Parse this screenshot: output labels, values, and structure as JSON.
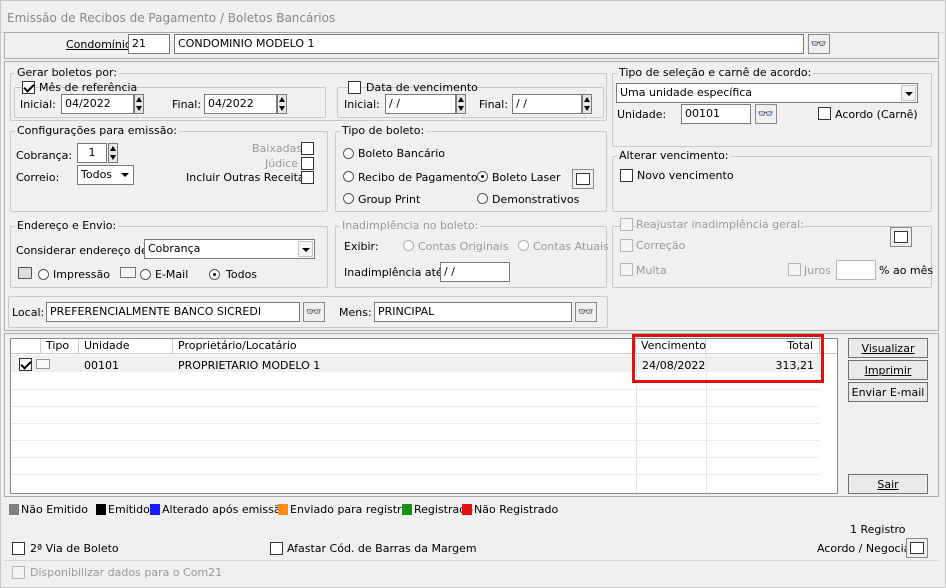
{
  "title": "Emissão de Recibos de Pagamento / Boletos Bancários",
  "condominio": {
    "label": "Condomínio:",
    "code": "21",
    "name": "CONDOMINIO MODELO 1"
  },
  "gerar": {
    "title": "Gerar boletos por:",
    "mes_label": "Mês de referência",
    "inicial_label": "Inicial:",
    "inicial": "04/2022",
    "final_label": "Final:",
    "final": "04/2022",
    "data_label": "Data de vencimento",
    "data_inicial": " / /",
    "data_final": " / /"
  },
  "tipo_selecao": {
    "title": "Tipo de seleção e carnê de acordo:",
    "selected": "Uma unidade específica",
    "unidade_label": "Unidade:",
    "unidade": "00101",
    "acordo_label": "Acordo (Carnê)"
  },
  "config": {
    "title": "Configurações para emissão:",
    "cobranca_label": "Cobrança:",
    "cobranca": "1",
    "correio_label": "Correio:",
    "correio": "Todos",
    "baixadas": "Baixadas",
    "judice": "Júdice",
    "incluir": "Incluir Outras Receitas"
  },
  "tipo_boleto": {
    "title": "Tipo de boleto:",
    "bancario": "Boleto Bancário",
    "recibo": "Recibo de Pagamento",
    "laser": "Boleto Laser",
    "group": "Group Print",
    "demonstrativos": "Demonstrativos"
  },
  "alterar": {
    "title": "Alterar vencimento:",
    "novo": "Novo vencimento"
  },
  "endereco": {
    "title": "Endereço e Envio:",
    "considerar_label": "Considerar endereço de:",
    "considerar": "Cobrança",
    "impressao": "Impressão",
    "email": "E-Mail",
    "todos": "Todos"
  },
  "inad": {
    "title": "Inadimplência no boleto:",
    "exibir": "Exibir:",
    "originais": "Contas Originais",
    "atuais": "Contas Atuais",
    "ate_label": "Inadimplência até:",
    "ate": " / /"
  },
  "reajustar": {
    "title": "Reajustar inadimplência geral:",
    "correcao": "Correção",
    "multa": "Multa",
    "juros": "Juros",
    "ao_mes": "% ao mês"
  },
  "local": {
    "label": "Local:",
    "value": "PREFERENCIALMENTE BANCO SICREDI",
    "mens_label": "Mens:",
    "mens": "PRINCIPAL"
  },
  "table": {
    "headers": [
      "Tipo",
      "Unidade",
      "Proprietário/Locatário",
      "Vencimento",
      "Total"
    ],
    "rows": [
      {
        "unidade": "00101",
        "proprietario": "PROPRIETARIO MODELO 1",
        "vencimento": "24/08/2022",
        "total": "313,21"
      }
    ]
  },
  "buttons": {
    "visualizar": "Visualizar",
    "imprimir": "Imprimir",
    "enviar": "Enviar E-mail",
    "sair": "Sair"
  },
  "legend": [
    {
      "label": "Não Emitido",
      "color": "#808080"
    },
    {
      "label": "Emitido",
      "color": "#000000"
    },
    {
      "label": "Alterado após emissão",
      "color": "#1a1aff"
    },
    {
      "label": "Enviado para registro",
      "color": "#ff8c1a"
    },
    {
      "label": "Registrado",
      "color": "#1a8c1a"
    },
    {
      "label": "Não Registrado",
      "color": "#e01010"
    }
  ],
  "footer": {
    "registros": "1 Registro",
    "segunda_via": "2ª Via de Boleto",
    "afastar": "Afastar Cód. de Barras da Margem",
    "acordo": "Acordo / Negociar",
    "com21": "Disponibilizar dados para o Com21"
  }
}
